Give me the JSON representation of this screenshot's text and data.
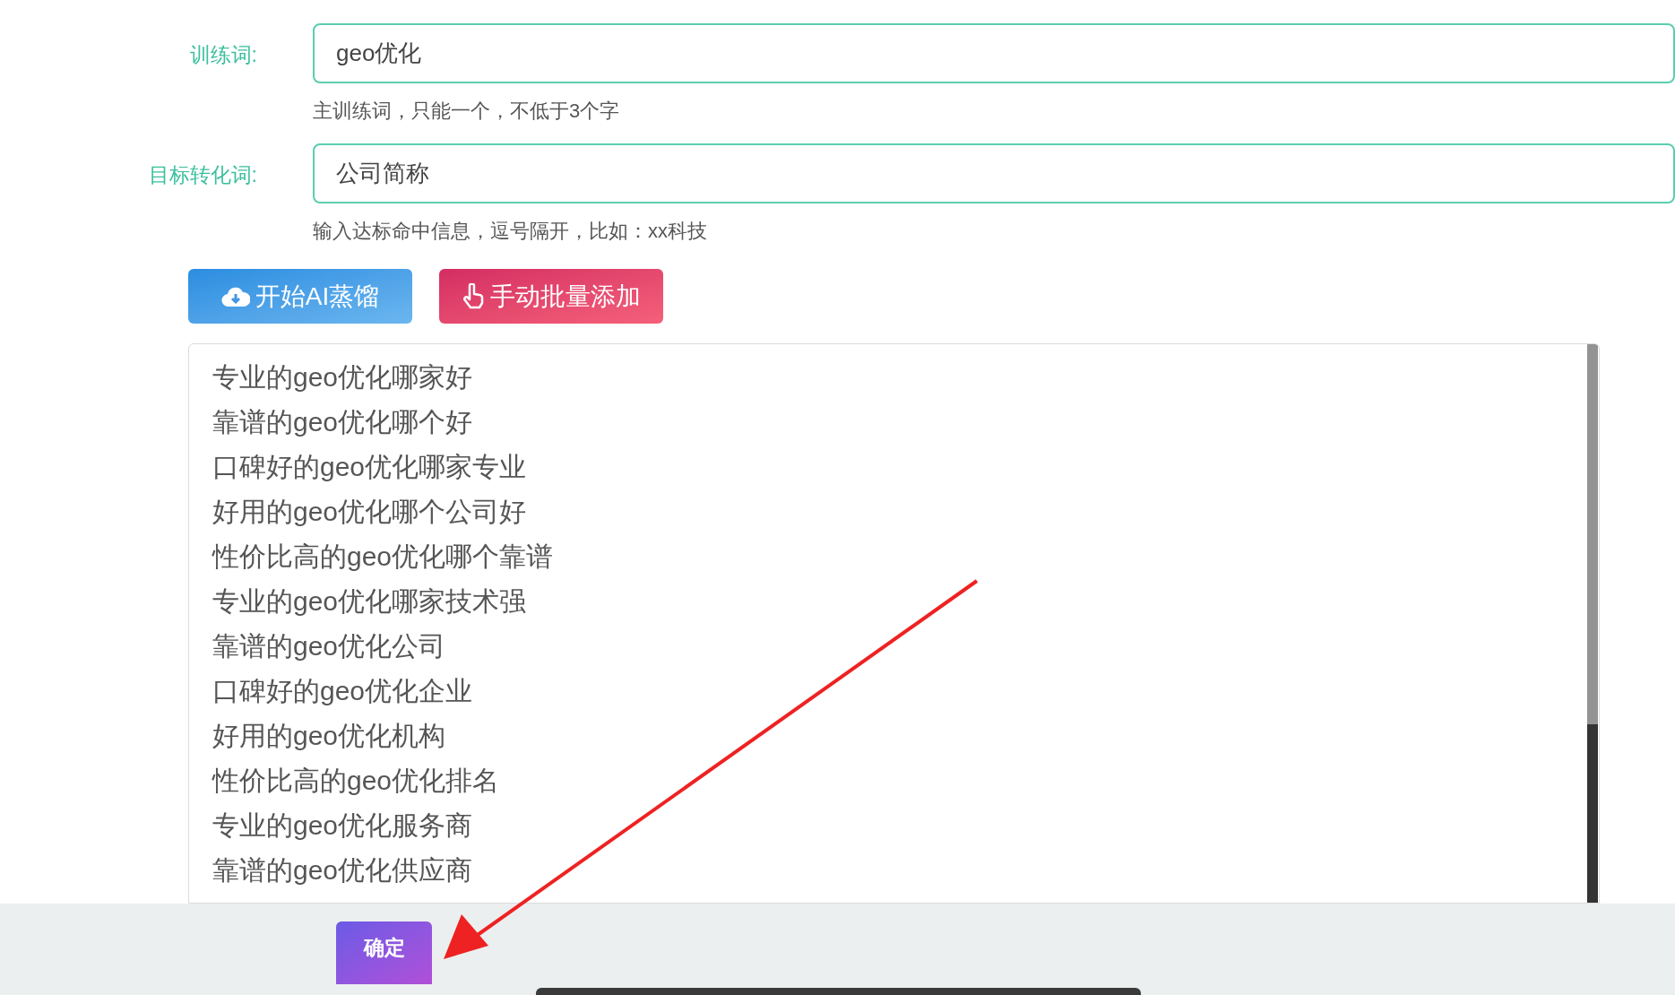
{
  "fields": [
    {
      "label": "训练词:",
      "value": "geo优化",
      "hint": "主训练词，只能一个，不低于3个字"
    },
    {
      "label": "目标转化词:",
      "value": "公司简称",
      "hint": "输入达标命中信息，逗号隔开，比如：xx科技"
    }
  ],
  "buttons": [
    {
      "kind": "distill",
      "label": "开始AI蒸馏"
    },
    {
      "kind": "manual",
      "label": "手动批量添加"
    }
  ],
  "keywords": [
    "专业的geo优化哪家好",
    "靠谱的geo优化哪个好",
    "口碑好的geo优化哪家专业",
    "好用的geo优化哪个公司好",
    "性价比高的geo优化哪个靠谱",
    "专业的geo优化哪家技术强",
    "靠谱的geo优化公司",
    "口碑好的geo优化企业",
    "好用的geo优化机构",
    "性价比高的geo优化排名",
    "专业的geo优化服务商",
    "靠谱的geo优化供应商"
  ],
  "confirm": "确定"
}
